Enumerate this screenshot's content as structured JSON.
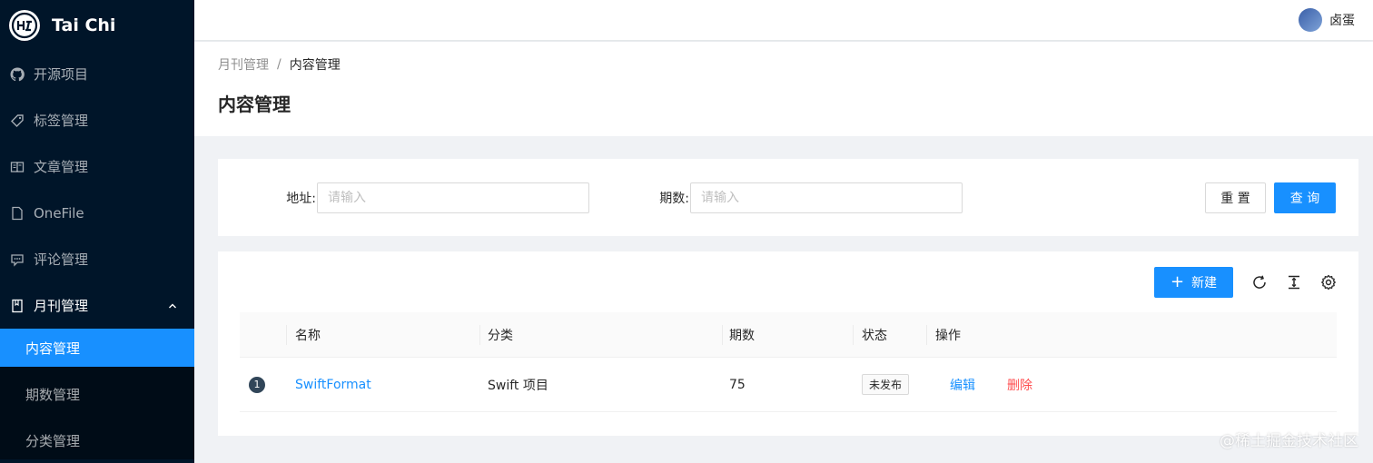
{
  "app": {
    "title": "Tai Chi"
  },
  "sidebar": {
    "items": [
      {
        "label": "开源项目",
        "icon": "github-icon"
      },
      {
        "label": "标签管理",
        "icon": "tag-icon"
      },
      {
        "label": "文章管理",
        "icon": "read-icon"
      },
      {
        "label": "OneFile",
        "icon": "file-icon"
      },
      {
        "label": "评论管理",
        "icon": "comment-icon"
      },
      {
        "label": "月刊管理",
        "icon": "book-icon",
        "expanded": true
      }
    ],
    "submenu": [
      {
        "label": "内容管理",
        "active": true
      },
      {
        "label": "期数管理",
        "active": false
      },
      {
        "label": "分类管理",
        "active": false
      }
    ]
  },
  "header": {
    "username": "卤蛋"
  },
  "breadcrumb": {
    "parent": "月刊管理",
    "separator": "/",
    "current": "内容管理"
  },
  "page": {
    "title": "内容管理"
  },
  "search": {
    "address_label": "地址",
    "address_placeholder": "请输入",
    "address_value": "",
    "issue_label": "期数",
    "issue_placeholder": "请输入",
    "issue_value": "",
    "reset_label": "重 置",
    "query_label": "查 询"
  },
  "toolbar": {
    "new_label": "新建"
  },
  "table": {
    "columns": [
      "名称",
      "分类",
      "期数",
      "状态",
      "操作"
    ],
    "rows": [
      {
        "index": "1",
        "name": "SwiftFormat",
        "category": "Swift 项目",
        "issue": "75",
        "status": "未发布",
        "edit": "编辑",
        "delete": "删除"
      }
    ]
  },
  "watermark": "@稀土掘金技术社区",
  "colors": {
    "primary": "#1890ff",
    "sider": "#001529",
    "danger": "#ff4d4f"
  }
}
